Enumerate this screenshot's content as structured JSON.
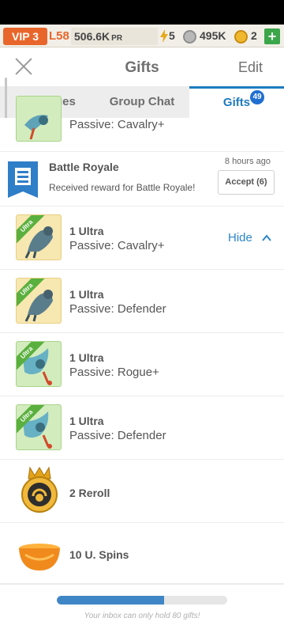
{
  "topbar": {
    "vip": "VIP 3",
    "level": "L58",
    "power": "506.6K",
    "power_unit": "PR",
    "energy": "5",
    "wolf_count": "495K",
    "coins": "2",
    "plus": "+"
  },
  "header": {
    "title": "Gifts",
    "edit": "Edit"
  },
  "tabs": {
    "messages": "Messages",
    "group_chat": "Group Chat",
    "gifts": "Gifts",
    "gifts_count": "49"
  },
  "event": {
    "name": "Battle Royale",
    "description": "Received reward for Battle Royale!",
    "time": "8 hours ago",
    "accept": "Accept (6)"
  },
  "items": [
    {
      "passive": "Passive: Cavalry+"
    },
    {
      "qty": "1 Ultra",
      "passive": "Passive: Cavalry+",
      "ribbon": "Ultra"
    },
    {
      "qty": "1 Ultra",
      "passive": "Passive: Defender",
      "ribbon": "Ultra"
    },
    {
      "qty": "1 Ultra",
      "passive": "Passive: Rogue+",
      "ribbon": "Ultra"
    },
    {
      "qty": "1 Ultra",
      "passive": "Passive: Defender",
      "ribbon": "Ultra"
    },
    {
      "label": "2 Reroll"
    },
    {
      "label": "10 U. Spins"
    }
  ],
  "hide": "Hide",
  "footer": {
    "note": "Your inbox can only hold 80 gifts!",
    "fill_fraction": 0.63
  },
  "colors": {
    "accent": "#1f7bbf",
    "vip": "#e8662b",
    "progress": "#3f86c6"
  }
}
